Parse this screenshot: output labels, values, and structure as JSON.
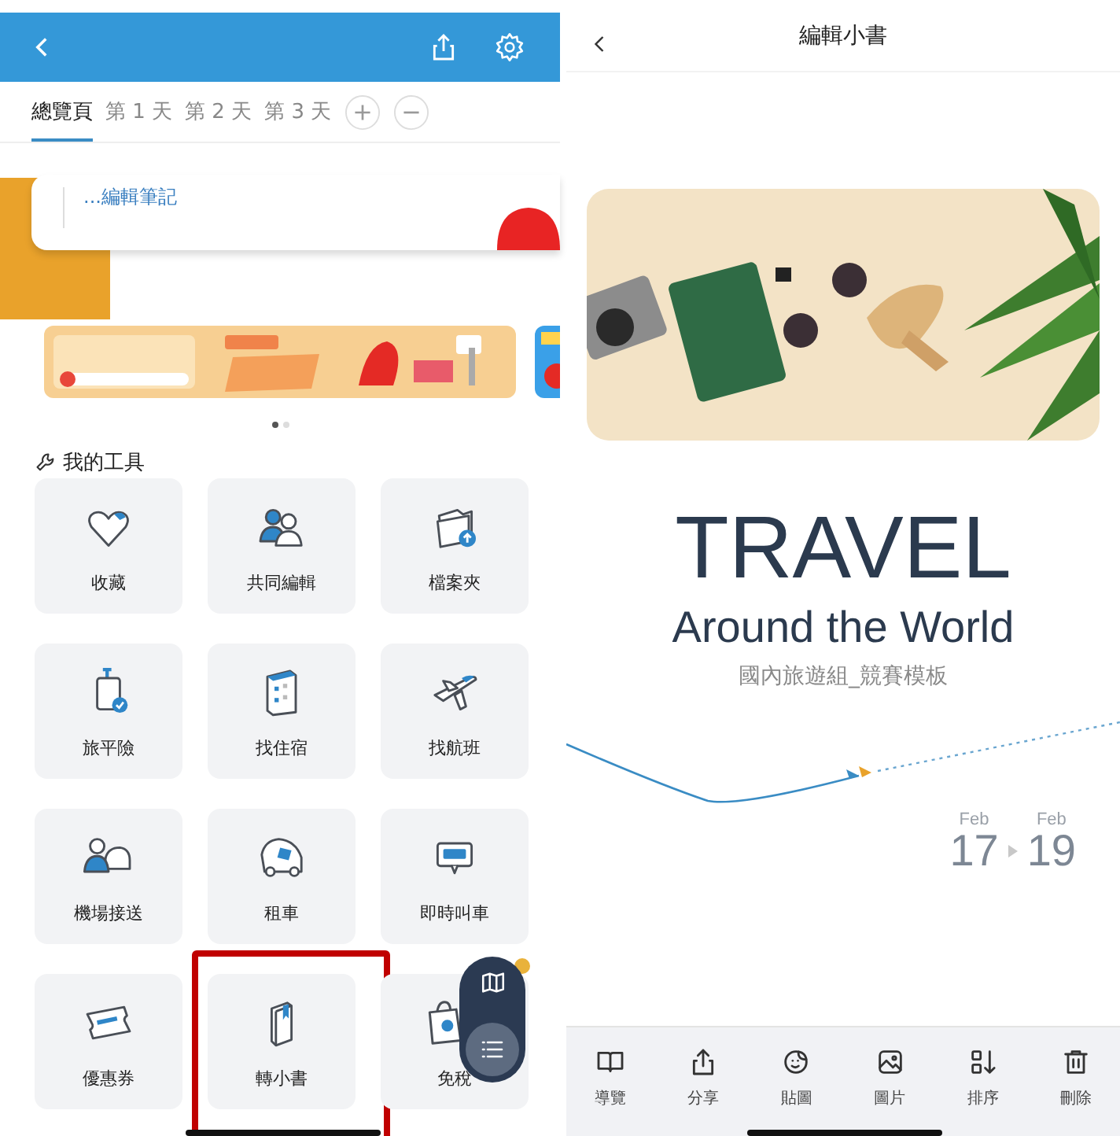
{
  "left": {
    "tabs": [
      {
        "label": "總覽頁",
        "selected": true
      },
      {
        "label": "第 1 天",
        "selected": false
      },
      {
        "label": "第 2 天",
        "selected": false
      },
      {
        "label": "第 3 天",
        "selected": false
      }
    ],
    "note": "...編輯筆記",
    "pager": [
      {
        "selected": true
      },
      {
        "selected": false
      }
    ],
    "tools_title": "我的工具",
    "tools": [
      {
        "label": "收藏",
        "highlighted": false
      },
      {
        "label": "共同編輯",
        "highlighted": false
      },
      {
        "label": "檔案夾",
        "highlighted": false
      },
      {
        "label": "旅平險",
        "highlighted": false
      },
      {
        "label": "找住宿",
        "highlighted": false
      },
      {
        "label": "找航班",
        "highlighted": false
      },
      {
        "label": "機場接送",
        "highlighted": false
      },
      {
        "label": "租車",
        "highlighted": false
      },
      {
        "label": "即時叫車",
        "highlighted": false
      },
      {
        "label": "優惠券",
        "highlighted": false
      },
      {
        "label": "轉小書",
        "highlighted": true
      },
      {
        "label": "免稅",
        "highlighted": false
      }
    ]
  },
  "right": {
    "title": "編輯小書",
    "cover": {
      "title": "TRAVEL",
      "subtitle": "Around the World",
      "caption": "國內旅遊組_競賽模板",
      "start": {
        "month": "Feb",
        "day": "17"
      },
      "end": {
        "month": "Feb",
        "day": "19"
      }
    },
    "toolbar": [
      {
        "label": "導覽"
      },
      {
        "label": "分享"
      },
      {
        "label": "貼圖"
      },
      {
        "label": "圖片"
      },
      {
        "label": "排序"
      },
      {
        "label": "刪除"
      }
    ]
  }
}
